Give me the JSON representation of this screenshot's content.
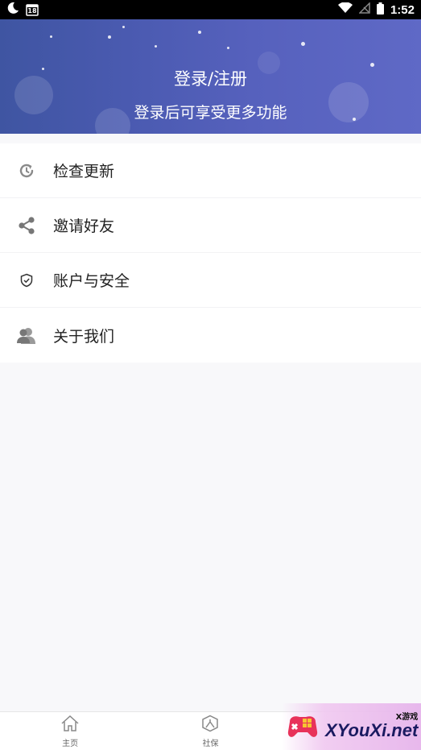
{
  "status_bar": {
    "time": "1:52",
    "calendar_day": "18"
  },
  "header": {
    "title": "登录/注册",
    "subtitle": "登录后可享受更多功能"
  },
  "menu": {
    "items": [
      {
        "label": "检查更新",
        "icon": "refresh-icon"
      },
      {
        "label": "邀请好友",
        "icon": "share-icon"
      },
      {
        "label": "账户与安全",
        "icon": "shield-icon"
      },
      {
        "label": "关于我们",
        "icon": "users-icon"
      }
    ]
  },
  "bottom_nav": {
    "items": [
      {
        "label": "主页",
        "icon": "home-icon"
      },
      {
        "label": "社保",
        "icon": "social-security-icon"
      },
      {
        "label": "",
        "icon": "profile-icon"
      }
    ]
  },
  "watermark": {
    "small": "X游戏",
    "big": "XYouXi.net"
  }
}
